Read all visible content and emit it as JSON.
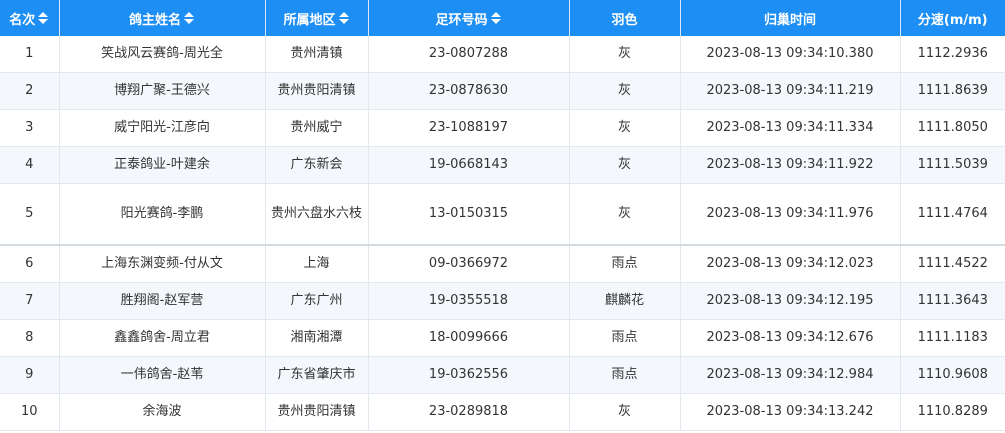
{
  "columns": [
    {
      "label": "名次",
      "sortable": true
    },
    {
      "label": "鸽主姓名",
      "sortable": true
    },
    {
      "label": "所属地区",
      "sortable": true
    },
    {
      "label": "足环号码",
      "sortable": true
    },
    {
      "label": "羽色",
      "sortable": false
    },
    {
      "label": "归巢时间",
      "sortable": false
    },
    {
      "label": "分速(m/m)",
      "sortable": false
    }
  ],
  "rows": [
    {
      "rank": "1",
      "owner": "笑战风云赛鸽-周光全",
      "region": "贵州清镇",
      "ring": "23-0807288",
      "color": "灰",
      "time": "2023-08-13 09:34:10.380",
      "speed": "1112.2936"
    },
    {
      "rank": "2",
      "owner": "博翔广聚-王德兴",
      "region": "贵州贵阳清镇",
      "ring": "23-0878630",
      "color": "灰",
      "time": "2023-08-13 09:34:11.219",
      "speed": "1111.8639"
    },
    {
      "rank": "3",
      "owner": "威宁阳光-江彦向",
      "region": "贵州威宁",
      "ring": "23-1088197",
      "color": "灰",
      "time": "2023-08-13 09:34:11.334",
      "speed": "1111.8050"
    },
    {
      "rank": "4",
      "owner": "正泰鸽业-叶建余",
      "region": "广东新会",
      "ring": "19-0668143",
      "color": "灰",
      "time": "2023-08-13 09:34:11.922",
      "speed": "1111.5039"
    },
    {
      "rank": "5",
      "owner": "阳光赛鸽-李鹏",
      "region": "贵州六盘水六枝",
      "ring": "13-0150315",
      "color": "灰",
      "time": "2023-08-13 09:34:11.976",
      "speed": "1111.4764"
    },
    {
      "rank": "6",
      "owner": "上海东渊变频-付从文",
      "region": "上海",
      "ring": "09-0366972",
      "color": "雨点",
      "time": "2023-08-13 09:34:12.023",
      "speed": "1111.4522"
    },
    {
      "rank": "7",
      "owner": "胜翔阁-赵军营",
      "region": "广东广州",
      "ring": "19-0355518",
      "color": "麒麟花",
      "time": "2023-08-13 09:34:12.195",
      "speed": "1111.3643"
    },
    {
      "rank": "8",
      "owner": "鑫鑫鸽舍-周立君",
      "region": "湘南湘潭",
      "ring": "18-0099666",
      "color": "雨点",
      "time": "2023-08-13 09:34:12.676",
      "speed": "1111.1183"
    },
    {
      "rank": "9",
      "owner": "一伟鸽舍-赵苇",
      "region": "广东省肇庆市",
      "ring": "19-0362556",
      "color": "雨点",
      "time": "2023-08-13 09:34:12.984",
      "speed": "1110.9608"
    },
    {
      "rank": "10",
      "owner": "余海波",
      "region": "贵州贵阳清镇",
      "ring": "23-0289818",
      "color": "灰",
      "time": "2023-08-13 09:34:13.242",
      "speed": "1110.8289"
    }
  ],
  "colors": {
    "header_bg": "#1d8ff4",
    "header_text": "#ffffff",
    "row_alt_bg": "#f4f7fb",
    "text": "#333333"
  },
  "icons": {
    "sort": "sort-updown-icon"
  }
}
